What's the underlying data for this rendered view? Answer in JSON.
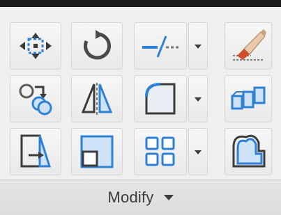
{
  "panel": {
    "title": "Modify",
    "colors": {
      "accent_blue": "#2e7fd6",
      "icon_dark": "#3b3b3b",
      "icon_gray": "#7a7a7a",
      "pen_orange": "#e06a1f"
    },
    "tools": [
      {
        "name": "move-icon",
        "row": 1,
        "col": 1
      },
      {
        "name": "rotate-icon",
        "row": 1,
        "col": 2
      },
      {
        "name": "trim-icon",
        "row": 1,
        "col": 3,
        "has_dropdown": true
      },
      {
        "name": "erase-icon",
        "row": 1,
        "col": 4
      },
      {
        "name": "copy-icon",
        "row": 2,
        "col": 1
      },
      {
        "name": "mirror-icon",
        "row": 2,
        "col": 2
      },
      {
        "name": "fillet-icon",
        "row": 2,
        "col": 3,
        "has_dropdown": true
      },
      {
        "name": "explode-icon",
        "row": 2,
        "col": 4
      },
      {
        "name": "stretch-icon",
        "row": 3,
        "col": 1
      },
      {
        "name": "scale-icon",
        "row": 3,
        "col": 2
      },
      {
        "name": "array-icon",
        "row": 3,
        "col": 3,
        "has_dropdown": true
      },
      {
        "name": "offset-icon",
        "row": 3,
        "col": 4
      }
    ]
  }
}
